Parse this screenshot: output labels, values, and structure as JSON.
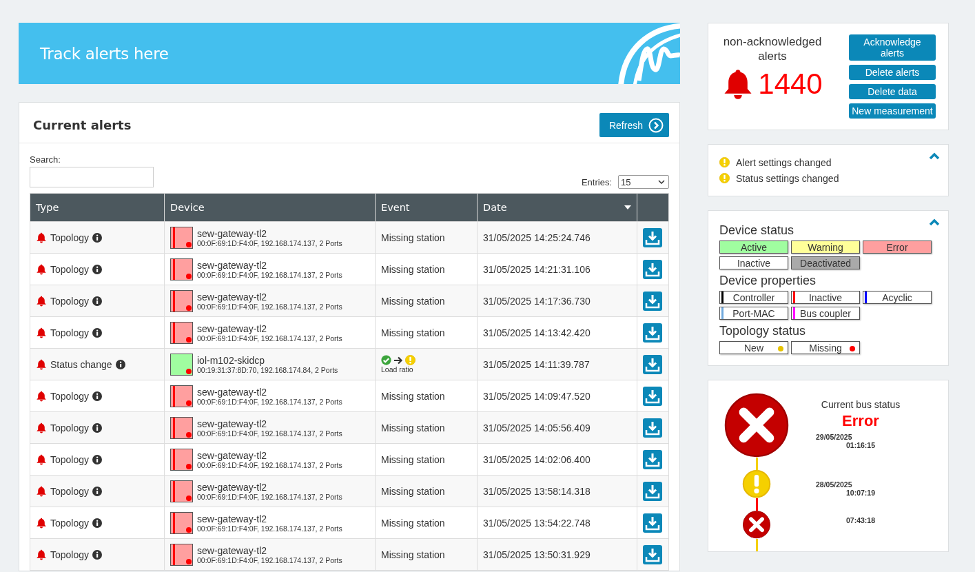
{
  "banner": {
    "title": "Track alerts here"
  },
  "alerts_panel": {
    "title": "Current alerts",
    "refresh_button": "Refresh",
    "search": {
      "label": "Search:"
    },
    "entries": {
      "label": "Entries:",
      "value": "15"
    },
    "table": {
      "columns": [
        {
          "label": "Type",
          "sorted": false
        },
        {
          "label": "Device",
          "sorted": false
        },
        {
          "label": "Event",
          "sorted": false
        },
        {
          "label": "Date",
          "sorted": true
        },
        {
          "sorted": false
        }
      ],
      "rows": [
        {
          "type": "Topology",
          "device": "sew-gateway-tl2",
          "info": "00:0F:69:1D:F4:0F, 192.168.174.137, 2 Ports",
          "kind": "error",
          "event": {
            "kind": "text",
            "text": "Missing station"
          },
          "date": "31/05/2025 14:25:24.746"
        },
        {
          "type": "Topology",
          "device": "sew-gateway-tl2",
          "info": "00:0F:69:1D:F4:0F, 192.168.174.137, 2 Ports",
          "kind": "error",
          "event": {
            "kind": "text",
            "text": "Missing station"
          },
          "date": "31/05/2025 14:21:31.106"
        },
        {
          "type": "Topology",
          "device": "sew-gateway-tl2",
          "info": "00:0F:69:1D:F4:0F, 192.168.174.137, 2 Ports",
          "kind": "error",
          "event": {
            "kind": "text",
            "text": "Missing station"
          },
          "date": "31/05/2025 14:17:36.730"
        },
        {
          "type": "Topology",
          "device": "sew-gateway-tl2",
          "info": "00:0F:69:1D:F4:0F, 192.168.174.137, 2 Ports",
          "kind": "error",
          "event": {
            "kind": "text",
            "text": "Missing station"
          },
          "date": "31/05/2025 14:13:42.420"
        },
        {
          "type": "Status change",
          "device": "iol-m102-skidcp",
          "info": "00:19:31:37:8D:70, 192.168.174.84, 2 Ports",
          "kind": "active",
          "event": {
            "kind": "transition",
            "icons": [
              {
                "kind": "ok"
              },
              {
                "kind": "warning"
              }
            ],
            "text": "Load ratio"
          },
          "date": "31/05/2025 14:11:39.787"
        },
        {
          "type": "Topology",
          "device": "sew-gateway-tl2",
          "info": "00:0F:69:1D:F4:0F, 192.168.174.137, 2 Ports",
          "kind": "error",
          "event": {
            "kind": "text",
            "text": "Missing station"
          },
          "date": "31/05/2025 14:09:47.520"
        },
        {
          "type": "Topology",
          "device": "sew-gateway-tl2",
          "info": "00:0F:69:1D:F4:0F, 192.168.174.137, 2 Ports",
          "kind": "error",
          "event": {
            "kind": "text",
            "text": "Missing station"
          },
          "date": "31/05/2025 14:05:56.409"
        },
        {
          "type": "Topology",
          "device": "sew-gateway-tl2",
          "info": "00:0F:69:1D:F4:0F, 192.168.174.137, 2 Ports",
          "kind": "error",
          "event": {
            "kind": "text",
            "text": "Missing station"
          },
          "date": "31/05/2025 14:02:06.400"
        },
        {
          "type": "Topology",
          "device": "sew-gateway-tl2",
          "info": "00:0F:69:1D:F4:0F, 192.168.174.137, 2 Ports",
          "kind": "error",
          "event": {
            "kind": "text",
            "text": "Missing station"
          },
          "date": "31/05/2025 13:58:14.318"
        },
        {
          "type": "Topology",
          "device": "sew-gateway-tl2",
          "info": "00:0F:69:1D:F4:0F, 192.168.174.137, 2 Ports",
          "kind": "error",
          "event": {
            "kind": "text",
            "text": "Missing station"
          },
          "date": "31/05/2025 13:54:22.748"
        },
        {
          "type": "Topology",
          "device": "sew-gateway-tl2",
          "info": "00:0F:69:1D:F4:0F, 192.168.174.137, 2 Ports",
          "kind": "error",
          "event": {
            "kind": "text",
            "text": "Missing station"
          },
          "date": "31/05/2025 13:50:31.929"
        }
      ]
    }
  },
  "counter_panel": {
    "title": "non-acknowledged alerts",
    "count": "1440",
    "buttons": [
      "Acknowledge alerts",
      "Delete alerts",
      "Delete data",
      "New measurement"
    ]
  },
  "notices": {
    "expanded": true,
    "items": [
      "Alert settings changed",
      "Status settings changed"
    ]
  },
  "legend": {
    "expanded": true,
    "device_status": {
      "title": "Device status",
      "items": [
        {
          "label": "Active",
          "color": "#a0fda0"
        },
        {
          "label": "Warning",
          "color": "#ffff99"
        },
        {
          "label": "Error",
          "color": "#ff9f9f"
        },
        {
          "label": "Inactive",
          "color": "#ffffff"
        },
        {
          "label": "Deactivated",
          "color": "#aaaaaa"
        }
      ]
    },
    "device_properties": {
      "title": "Device properties",
      "items": [
        {
          "label": "Controller",
          "color": "#000000"
        },
        {
          "label": "Inactive",
          "color": "#ff0000"
        },
        {
          "label": "Acyclic",
          "color": "#0000ff"
        },
        {
          "label": "Port-MAC",
          "color": "#6fa8dc"
        },
        {
          "label": "Bus coupler",
          "color": "#ff00ff"
        }
      ]
    },
    "topology_status": {
      "title": "Topology status",
      "items": [
        {
          "label": "New",
          "color": "#e6c200"
        },
        {
          "label": "Missing",
          "color": "#ff0000"
        }
      ]
    }
  },
  "bus_status": {
    "title": "Current bus status",
    "status": "Error",
    "history": [
      {
        "kind": "error",
        "date": "29/05/2025",
        "time": "01:16:15"
      },
      {
        "kind": "warning",
        "date": "28/05/2025",
        "time": "10:07:19"
      },
      {
        "kind": "error",
        "time": "07:43:18"
      }
    ]
  }
}
